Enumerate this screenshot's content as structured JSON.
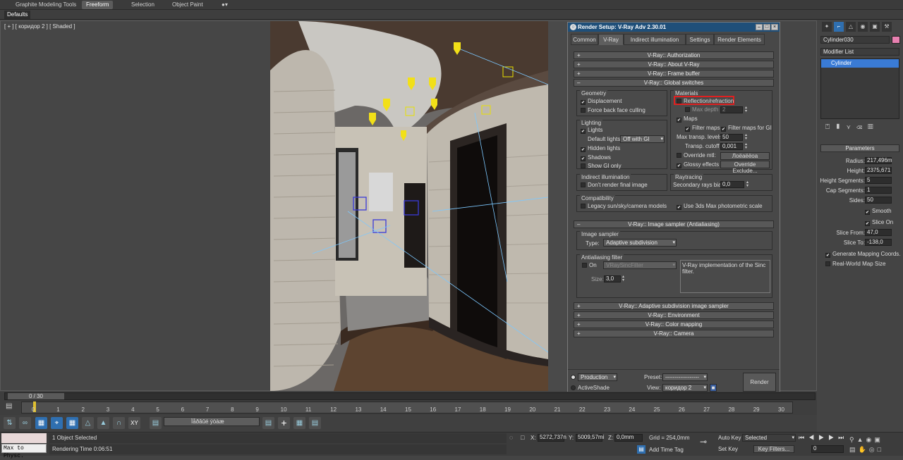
{
  "ribbon": {
    "tabs": [
      "Graphite Modeling Tools",
      "Freeform",
      "Selection",
      "Object Paint"
    ],
    "active_tab": "Freeform",
    "defaults_label": "Defaults"
  },
  "viewport": {
    "label": "[ + ] [ коридор 2 ] [ Shaded ]"
  },
  "render_dialog": {
    "title": "Render Setup: V-Ray Adv 2.30.01",
    "tabs": [
      "Common",
      "V-Ray",
      "Indirect illumination",
      "Settings",
      "Render Elements"
    ],
    "active_tab": "V-Ray",
    "rollouts_top": [
      "V-Ray:: Authorization",
      "V-Ray:: About V-Ray",
      "V-Ray:: Frame buffer",
      "V-Ray:: Global switches"
    ],
    "geometry": {
      "title": "Geometry",
      "displacement": "Displacement",
      "force_back": "Force back face culling"
    },
    "materials": {
      "title": "Materials",
      "reflection": "Reflection/refraction",
      "max_depth": "Max depth",
      "max_depth_val": "2",
      "maps": "Maps",
      "filter_maps": "Filter maps",
      "filter_maps_gi": "Filter maps for GI",
      "max_transp": "Max transp. levels",
      "max_transp_val": "50",
      "transp_cutoff": "Transp. cutoff",
      "transp_cutoff_val": "0,001",
      "override_mtl": "Override mtl:",
      "override_mtl_btn": "Лоёаёёоа",
      "glossy": "Glossy effects",
      "override_exclude": "Override Exclude..."
    },
    "lighting": {
      "title": "Lighting",
      "lights": "Lights",
      "default_lights": "Default lights",
      "default_lights_val": "Off with GI",
      "hidden_lights": "Hidden lights",
      "shadows": "Shadows",
      "show_gi": "Show GI only"
    },
    "indirect": {
      "title": "Indirect illumination",
      "dont_render": "Don't render final image"
    },
    "raytracing": {
      "title": "Raytracing",
      "secondary": "Secondary rays bias",
      "secondary_val": "0,0"
    },
    "compat": {
      "title": "Compatibility",
      "legacy": "Legacy sun/sky/camera models",
      "use3ds": "Use 3ds Max photometric scale"
    },
    "image_sampler_rollout": "V-Ray:: Image sampler (Antialiasing)",
    "image_sampler": {
      "title": "Image sampler",
      "type_label": "Type:",
      "type_val": "Adaptive subdivision"
    },
    "aa_filter": {
      "title": "Antialiasing filter",
      "on": "On",
      "filter_val": "VRaySincFilter",
      "desc": "V-Ray implementation of the Sinc filter.",
      "size_label": "Size:",
      "size_val": "3,0"
    },
    "rollouts_bottom": [
      "V-Ray:: Adaptive subdivision image sampler",
      "V-Ray:: Environment",
      "V-Ray:: Color mapping",
      "V-Ray:: Camera"
    ],
    "bottom": {
      "production": "Production",
      "activeshade": "ActiveShade",
      "preset_label": "Preset:",
      "preset_val": "------------------",
      "view_label": "View:",
      "view_val": "коридор 2",
      "render": "Render"
    }
  },
  "right_panel": {
    "object_name": "Cylinder030",
    "modifier_list": "Modifier List",
    "stack_item": "Cylinder",
    "params_title": "Parameters",
    "radius_label": "Radius:",
    "radius_val": "217,496m",
    "height_label": "Height:",
    "height_val": "2375,671",
    "height_seg_label": "Height Segments:",
    "height_seg_val": "5",
    "cap_seg_label": "Cap Segments:",
    "cap_seg_val": "1",
    "sides_label": "Sides:",
    "sides_val": "50",
    "smooth": "Smooth",
    "slice_on": "Slice On",
    "slice_from_label": "Slice From:",
    "slice_from_val": "47,0",
    "slice_to_label": "Slice To:",
    "slice_to_val": "-138,0",
    "gen_mapping": "Generate Mapping Coords.",
    "real_world": "Real-World Map Size"
  },
  "timeline": {
    "frame_label": "0 / 30",
    "ticks": [
      "0",
      "1",
      "2",
      "3",
      "4",
      "5",
      "6",
      "7",
      "8",
      "9",
      "10",
      "11",
      "12",
      "13",
      "14",
      "15",
      "16",
      "17",
      "18",
      "19",
      "20",
      "21",
      "22",
      "23",
      "24",
      "25",
      "26",
      "27",
      "28",
      "29",
      "30"
    ]
  },
  "toolbar": {
    "selection_set": "Ïåðâûé ýòàæ"
  },
  "status": {
    "maxscript": "Max to Physc.",
    "selected": "1 Object Selected",
    "render_time": "Rendering Time  0:06:51",
    "x_label": "X:",
    "x_val": "5272,737n",
    "y_label": "Y:",
    "y_val": "5009,57mi",
    "z_label": "Z:",
    "z_val": "0,0mm",
    "grid": "Grid = 254,0mm",
    "add_time_tag": "Add Time Tag",
    "auto_key": "Auto Key",
    "set_key": "Set Key",
    "selected_dd": "Selected",
    "key_filters": "Key Filters...",
    "frame_val": "0"
  },
  "colors": {
    "title_bar": "#1f4f79",
    "highlight_box": "#e02020",
    "stack_select": "#3a7bd5",
    "swatch": "#e880b0"
  }
}
